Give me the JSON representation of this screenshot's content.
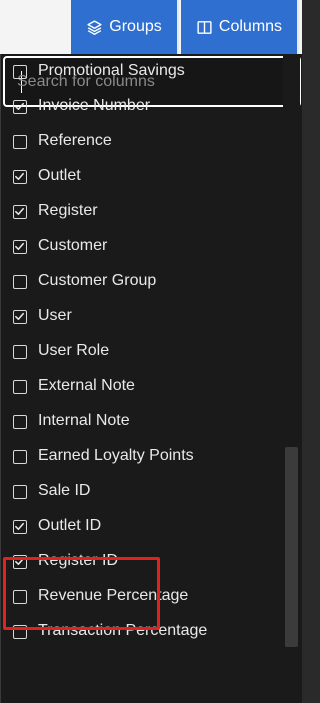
{
  "toolbar": {
    "groups_label": "Groups",
    "columns_label": "Columns",
    "groups_icon": "layers-icon",
    "columns_icon": "columns-icon"
  },
  "search": {
    "placeholder": "Search for columns",
    "value": ""
  },
  "columns": [
    {
      "label": "Promotional Savings",
      "checked": false
    },
    {
      "label": "Invoice Number",
      "checked": true
    },
    {
      "label": "Reference",
      "checked": false
    },
    {
      "label": "Outlet",
      "checked": true
    },
    {
      "label": "Register",
      "checked": true
    },
    {
      "label": "Customer",
      "checked": true
    },
    {
      "label": "Customer Group",
      "checked": false
    },
    {
      "label": "User",
      "checked": true
    },
    {
      "label": "User Role",
      "checked": false
    },
    {
      "label": "External Note",
      "checked": false
    },
    {
      "label": "Internal Note",
      "checked": false
    },
    {
      "label": "Earned Loyalty Points",
      "checked": false
    },
    {
      "label": "Sale ID",
      "checked": false
    },
    {
      "label": "Outlet ID",
      "checked": true
    },
    {
      "label": "Register ID",
      "checked": true
    },
    {
      "label": "Revenue Percentage",
      "checked": false
    },
    {
      "label": "Transaction Percentage",
      "checked": false
    }
  ],
  "colors": {
    "accent": "#2f6fd0",
    "highlight": "#e0231f",
    "panel": "#1a1a1a"
  }
}
